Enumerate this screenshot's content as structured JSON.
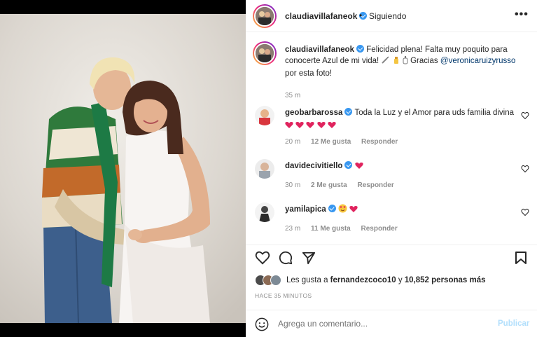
{
  "post": {
    "username": "claudiavillafaneok",
    "follow_status": "Siguiendo",
    "separator": "•",
    "more_label": "•••"
  },
  "caption": {
    "username": "claudiavillafaneok",
    "text_1": "Felicidad plena! Falta muy poquito para conocerte Azul de mi vida!",
    "text_2": "Gracias",
    "mention": "@veronicaruizyrusso",
    "text_3": "por esta foto!",
    "time": "35 m"
  },
  "comments": [
    {
      "username": "geobarbarossa",
      "text": "Toda la Luz y el Amor para uds familia divina",
      "time": "20 m",
      "likes": "12 Me gusta",
      "reply": "Responder"
    },
    {
      "username": "davidecivitiello",
      "text": "",
      "time": "30 m",
      "likes": "2 Me gusta",
      "reply": "Responder"
    },
    {
      "username": "yamilapica",
      "text": "",
      "time": "23 m",
      "likes": "11 Me gusta",
      "reply": "Responder"
    }
  ],
  "likes": {
    "prefix": "Les gusta a",
    "user": "fernandezcoco10",
    "middle": "y",
    "count": "10,852 personas más"
  },
  "time_ago": "HACE 35 MINUTOS",
  "add_comment": {
    "placeholder": "Agrega un comentario...",
    "post_label": "Publicar"
  },
  "colors": {
    "verified": "#3897f0",
    "heart": "#ed4956",
    "link": "#00376b",
    "muted": "#8e8e8e",
    "post_disabled": "#b2dffc"
  }
}
